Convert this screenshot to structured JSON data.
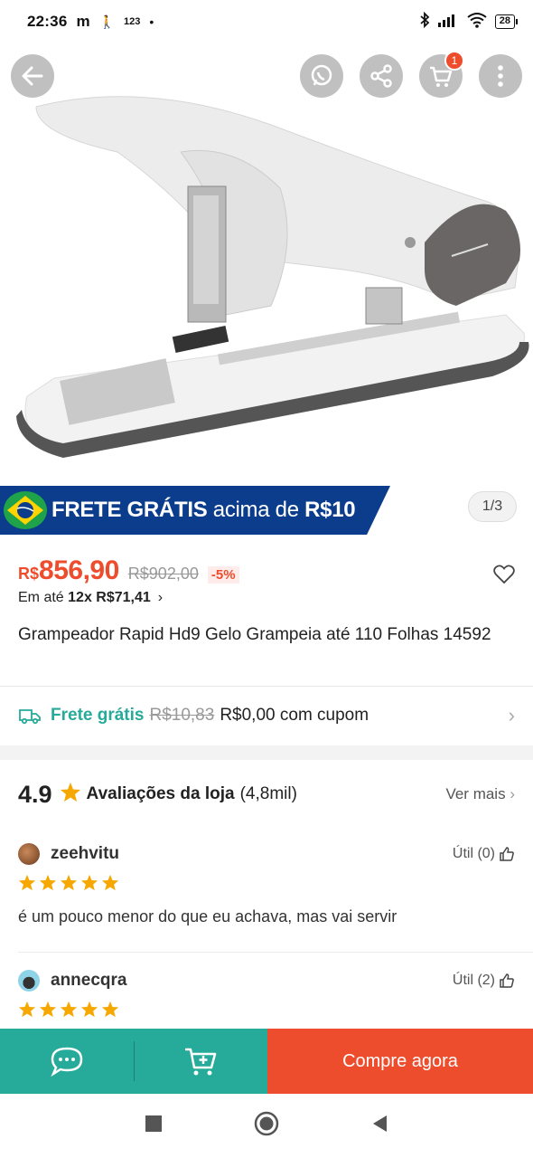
{
  "status": {
    "time": "22:36",
    "carrier_mark": "m",
    "counter": "123",
    "battery": "28"
  },
  "hero": {
    "image_desc_icon": "stapler-product-image",
    "cart_count": "1"
  },
  "banner": {
    "bold": "FRETE GRÁTIS",
    "rest": " acima de ",
    "amount": "R$10"
  },
  "pager": "1/3",
  "price": {
    "currency": "R$",
    "current": "856,90",
    "original": "R$902,00",
    "discount": "-5%",
    "installments_prefix": "Em até ",
    "installments": "12x R$71,41"
  },
  "product_title": "Grampeador Rapid Hd9 Gelo Grampeia até 110 Folhas 14592",
  "shipping": {
    "label": "Frete grátis",
    "original": "R$10,83",
    "value": "R$0,00 com cupom"
  },
  "ratings": {
    "score": "4.9",
    "label": "Avaliações da loja",
    "count": "(4,8mil)",
    "see_more": "Ver mais"
  },
  "reviews": [
    {
      "user": "zeehvitu",
      "useful": "Útil (0)",
      "stars": 5,
      "text": "é um pouco menor do que eu achava, mas vai servir"
    },
    {
      "user": "annecqra",
      "useful": "Útil (2)",
      "stars": 5
    }
  ],
  "bottom": {
    "buy_label": "Compre agora"
  },
  "colors": {
    "accent": "#ee4d2d",
    "teal": "#26aa99",
    "banner": "#0b3d8c",
    "star": "#f6a700"
  }
}
